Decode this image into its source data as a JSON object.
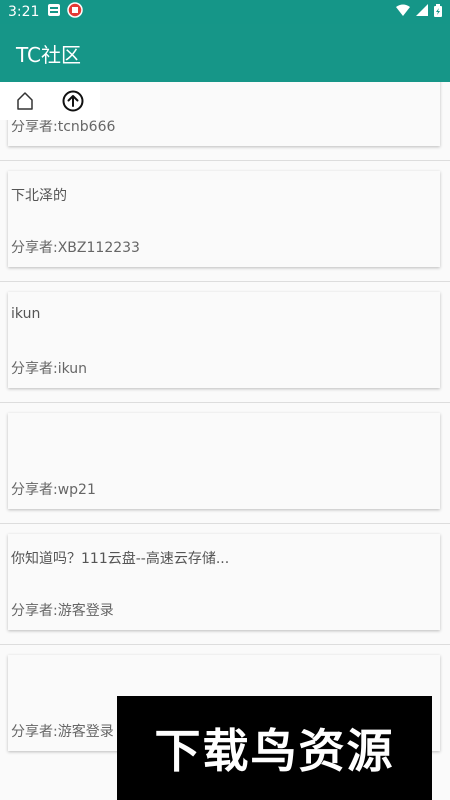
{
  "status_bar": {
    "time": "3:21"
  },
  "app_bar": {
    "title": "TC社区",
    "background_color": "#169688"
  },
  "toolbar": {
    "home_icon": "home-icon",
    "upload_icon": "upload-arrow-icon"
  },
  "feed": {
    "items": [
      {
        "title": "",
        "sharer": "分享者:tcnb666"
      },
      {
        "title": "下北泽的",
        "sharer": "分享者:XBZ112233"
      },
      {
        "title": "ikun",
        "sharer": "分享者:ikun"
      },
      {
        "title": "",
        "sharer": "分享者:wp21"
      },
      {
        "title": "你知道吗？111云盘--高速云存储...",
        "sharer": "分享者:游客登录"
      },
      {
        "title": "",
        "sharer": "分享者:游客登录"
      }
    ]
  },
  "watermark": {
    "text": "下载鸟资源"
  }
}
